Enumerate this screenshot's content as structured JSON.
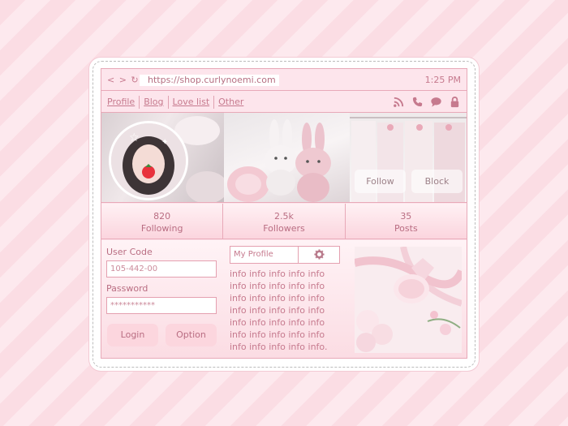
{
  "browser": {
    "nav_controls": "< > ↻",
    "url": "https://shop.curlynoemi.com",
    "clock": "1:25 PM"
  },
  "menu": {
    "links": [
      "Profile",
      "Blog",
      "Love list",
      "Other"
    ],
    "icons": [
      "rss-icon",
      "phone-icon",
      "chat-icon",
      "lock-icon"
    ]
  },
  "banner": {
    "follow_label": "Follow",
    "block_label": "Block"
  },
  "stats": [
    {
      "value": "820",
      "label": "Following"
    },
    {
      "value": "2.5k",
      "label": "Followers"
    },
    {
      "value": "35",
      "label": "Posts"
    }
  ],
  "login": {
    "user_code_label": "User Code",
    "user_code_value": "105-442-00",
    "password_label": "Password",
    "password_value": "***********",
    "login_label": "Login",
    "option_label": "Option"
  },
  "profile": {
    "tab_label": "My Profile",
    "info_text": "info info info info info info info info info info info info info info info info info info info info info info info info info info info info info info info info info info info."
  },
  "colors": {
    "accent": "#c67a8e",
    "border": "#e8a9b8",
    "panel": "#fde3ea",
    "stripe_a": "#fbdde4",
    "stripe_b": "#fde9ee"
  }
}
